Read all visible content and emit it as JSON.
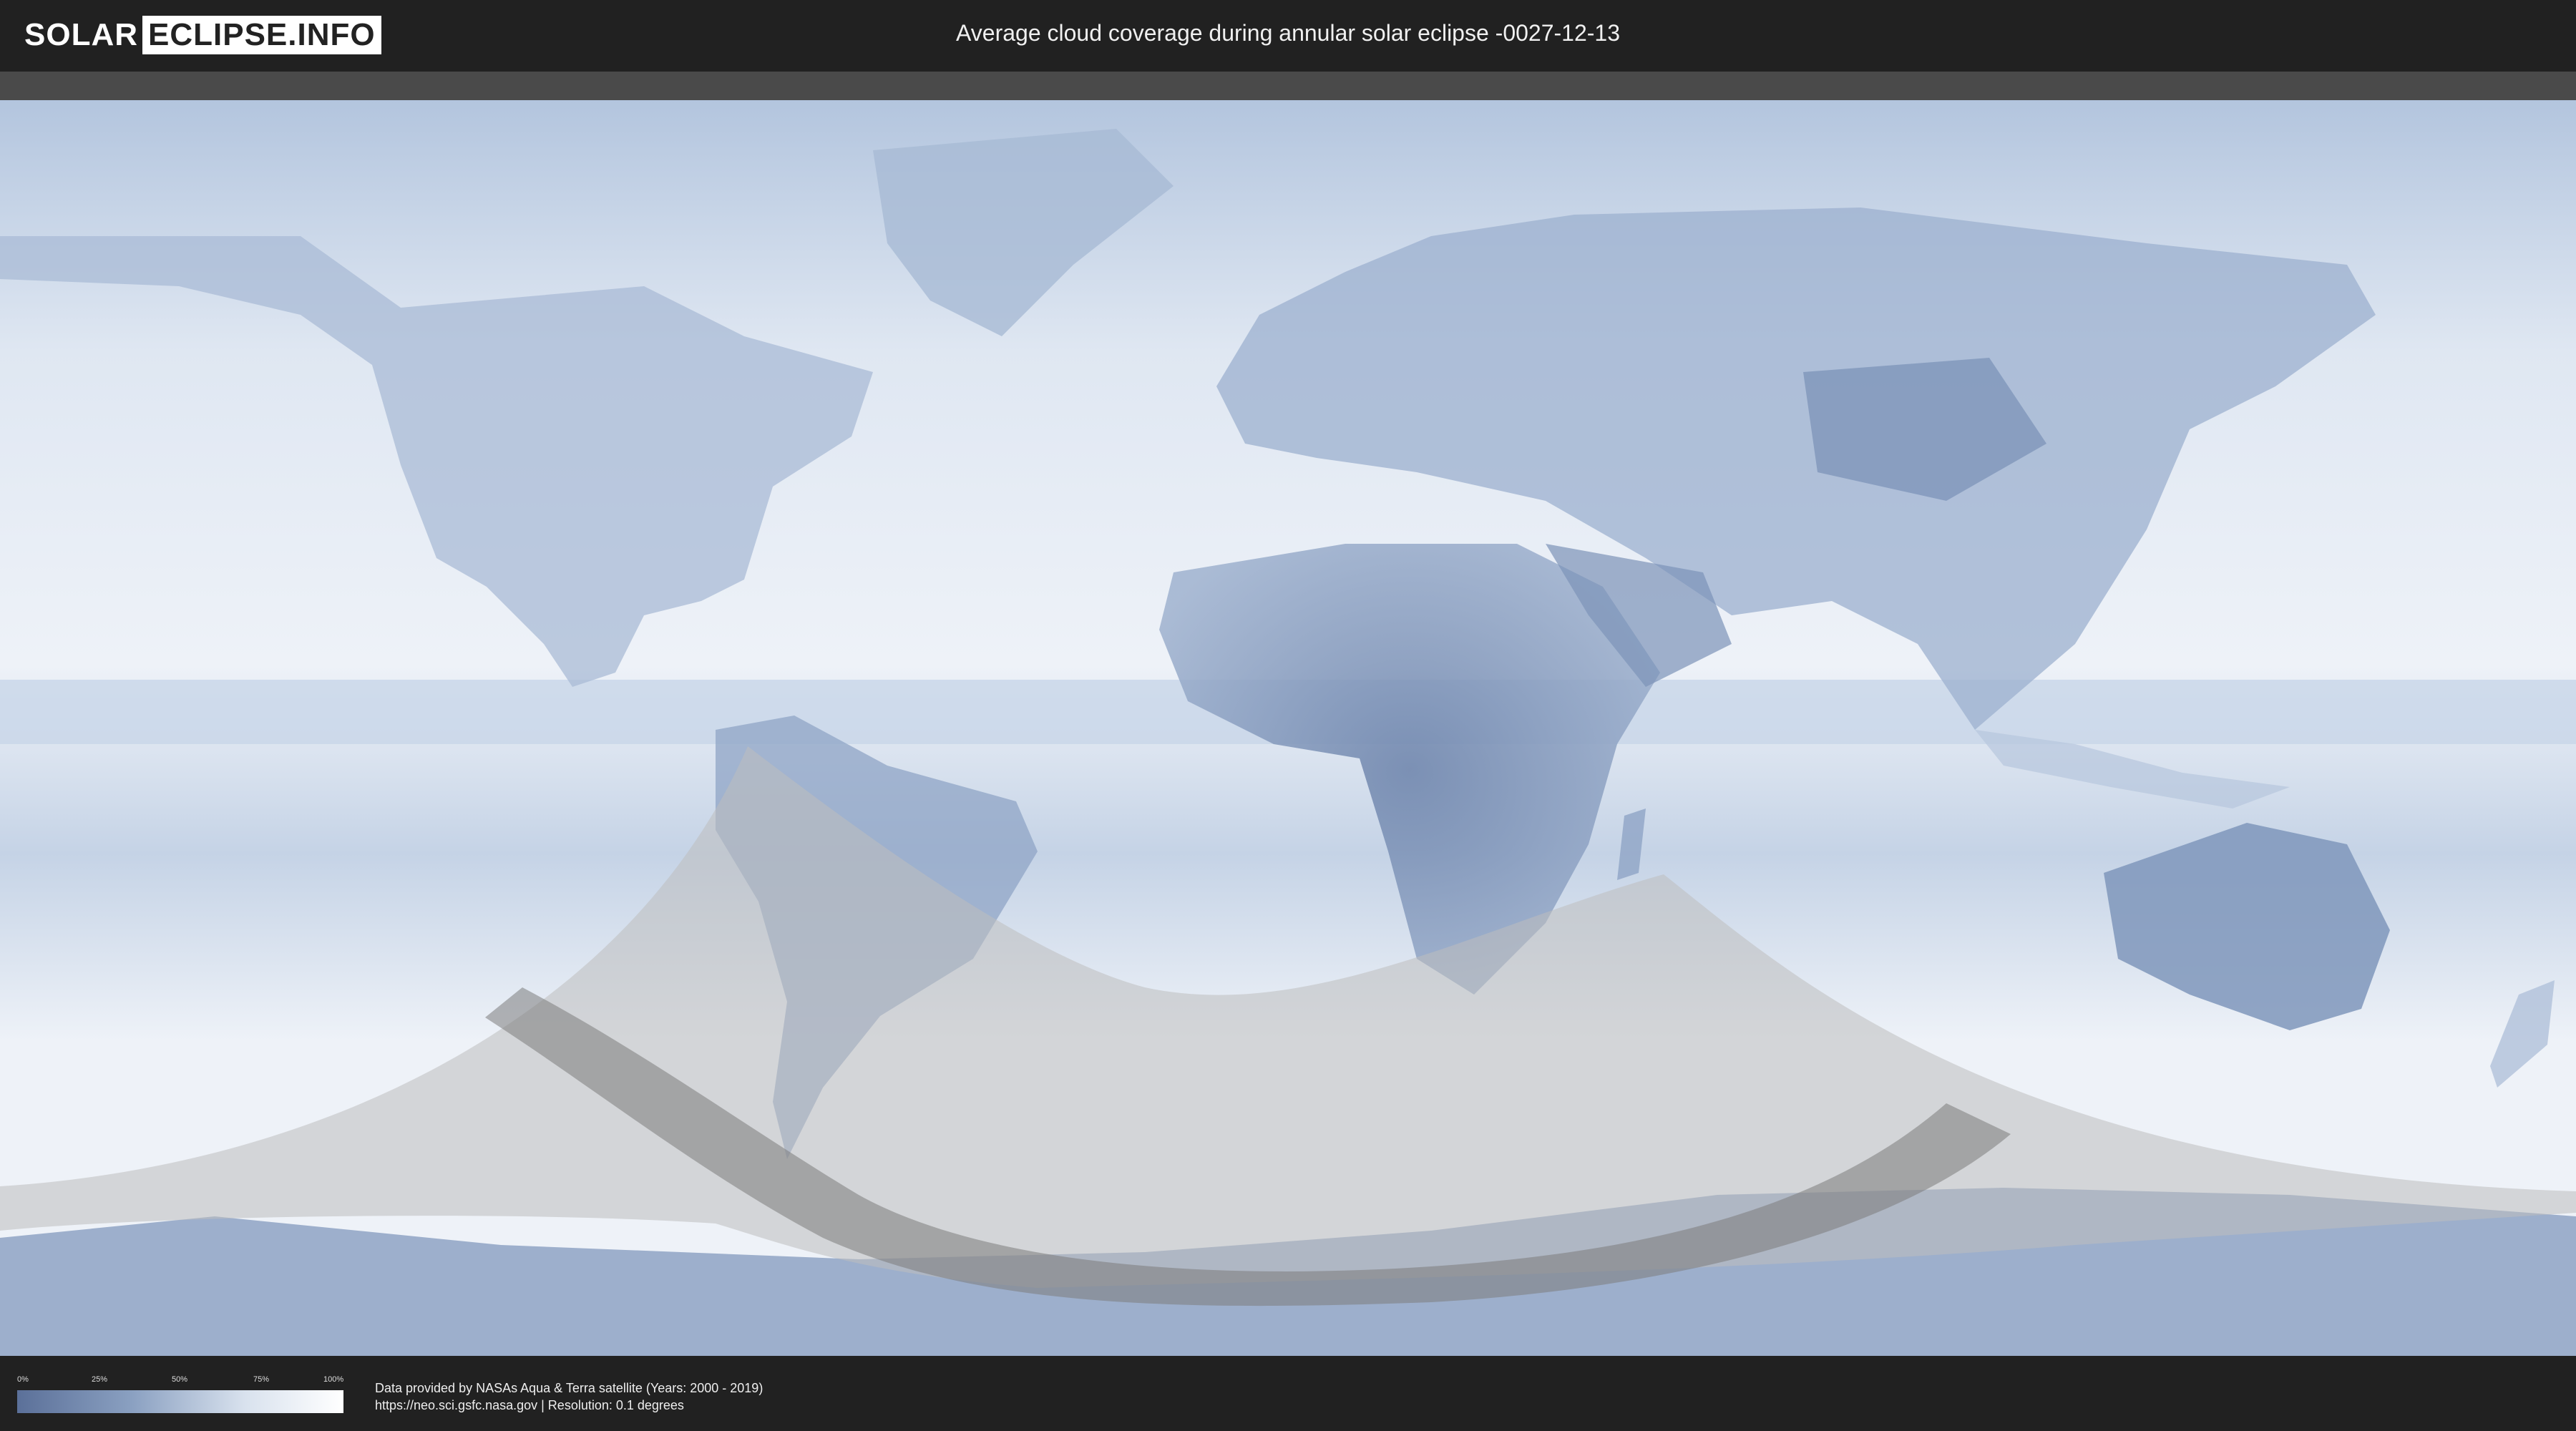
{
  "header": {
    "logo_part1": "SOLAR",
    "logo_part2": "ECLIPSE.INFO",
    "title": "Average cloud coverage during annular solar eclipse -0027-12-13"
  },
  "legend": {
    "ticks": [
      "0%",
      "25%",
      "50%",
      "75%",
      "100%"
    ],
    "colors": {
      "low": "#5b7099",
      "high": "#ffffff"
    }
  },
  "footer": {
    "line1": "Data provided by NASAs Aqua & Terra satellite (Years: 2000 - 2019)",
    "line2": "https://neo.sci.gsfc.nasa.gov | Resolution: 0.1 degrees"
  },
  "colors": {
    "background": "#212121",
    "ocean_cloud": "#e8eef6",
    "land_clear": "#6d85ad",
    "eclipse_zone": "#bfbfbf",
    "central_path": "#7d7d7d"
  }
}
